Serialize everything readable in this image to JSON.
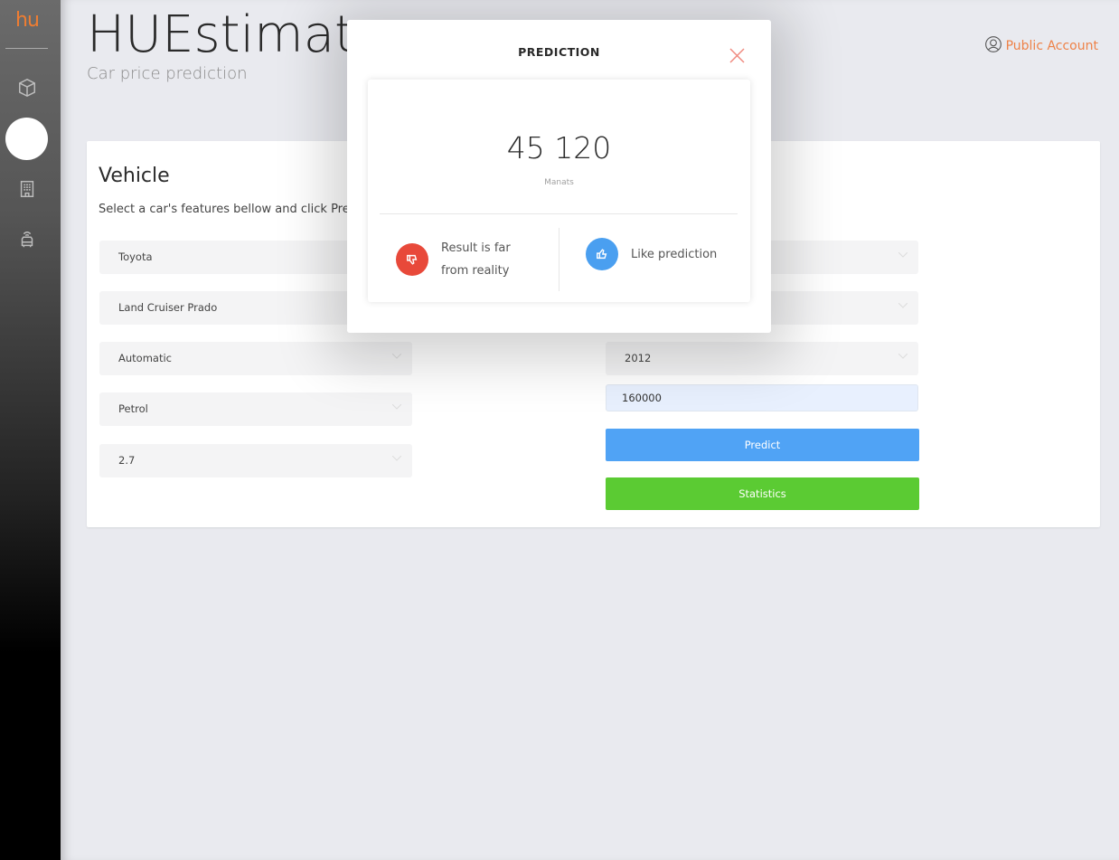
{
  "sidebar": {
    "logo": "hu",
    "items": [
      {
        "icon": "cube-icon"
      },
      {
        "icon": "active-indicator"
      },
      {
        "icon": "building-icon"
      },
      {
        "icon": "taxi-icon"
      }
    ]
  },
  "header": {
    "title": "HUEstimator",
    "subtitle": "Car price prediction",
    "account_label": "Public Account"
  },
  "card": {
    "title": "Vehicle",
    "description": "Select a car's features bellow and click Predict",
    "left_selects": [
      {
        "name": "make",
        "value": "Toyota"
      },
      {
        "name": "model",
        "value": "Land Cruiser Prado"
      },
      {
        "name": "transmission",
        "value": "Automatic"
      },
      {
        "name": "fuel",
        "value": "Petrol"
      },
      {
        "name": "engine",
        "value": "2.7"
      }
    ],
    "right_selects": [
      {
        "name": "select-1",
        "value": ""
      },
      {
        "name": "select-2",
        "value": ""
      },
      {
        "name": "year",
        "value": "2012"
      }
    ],
    "mileage_input": "160000",
    "predict_label": "Predict",
    "statistics_label": "Statistics"
  },
  "modal": {
    "title": "PREDICTION",
    "price": "45 120",
    "currency": "Manats",
    "dislike_label": "Result is far from reality",
    "like_label": "Like prediction"
  },
  "colors": {
    "accent": "#ee8248",
    "predict": "#50a3f5",
    "statistics": "#5bcb33",
    "dislike": "#e8493a",
    "like": "#4a9ff0"
  }
}
